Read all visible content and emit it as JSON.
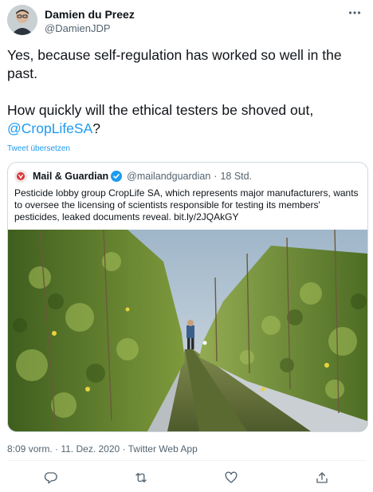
{
  "author": {
    "name": "Damien du Preez",
    "handle": "@DamienJDP"
  },
  "tweet": {
    "text_line1": "Yes, because self-regulation has worked so well in the past.",
    "text_line2_prefix": "How quickly will the ethical testers be shoved out,",
    "mention": "@CropLifeSA",
    "text_line2_suffix": "?",
    "translate_label": "Tweet übersetzen"
  },
  "quoted_tweet": {
    "name": "Mail & Guardian",
    "handle": "@mailandguardian",
    "separator": "·",
    "time": "18 Std.",
    "text": "Pesticide lobby group CropLife SA, which represents major manufacturers, wants to oversee the licensing of scientists responsible for testing its members' pesticides, leaked documents reveal. ",
    "link": "bit.ly/2JQAkGY"
  },
  "meta": {
    "timestamp": "8:09 vorm. · 11. Dez. 2020 · Twitter Web App"
  },
  "actions": {
    "reply": "reply-icon",
    "retweet": "retweet-icon",
    "like": "heart-icon",
    "share": "share-icon"
  },
  "colors": {
    "accent": "#1d9bf0",
    "text": "#0f1419",
    "secondary": "#536471",
    "border": "#cfd9de"
  }
}
